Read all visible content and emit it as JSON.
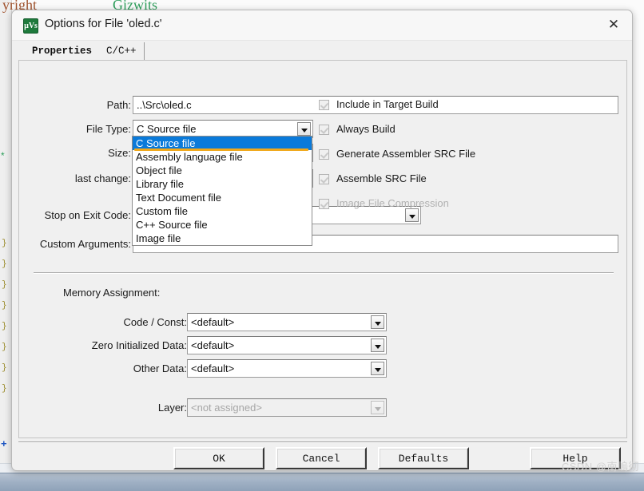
{
  "background": {
    "code_line_left": "yright",
    "code_line_right": "Gizwits",
    "gutter_marks": [
      "}",
      "}",
      "}",
      "}",
      "}",
      "}",
      "}",
      "}"
    ],
    "star_glyph": "*",
    "plus_glyph": "+",
    "slash_glyph": "/"
  },
  "dialog": {
    "title": "Options for File 'oled.c'",
    "icon": "uvision-icon",
    "icon_glyph": "µVs",
    "close_glyph": "✕"
  },
  "tabs": [
    {
      "label": "Properties",
      "active": true
    },
    {
      "label": "C/C++",
      "active": false
    }
  ],
  "fields": {
    "path_label": "Path:",
    "path_value": "..\\Src\\oled.c",
    "file_type_label": "File Type:",
    "file_type_value": "C Source file",
    "size_label": "Size:",
    "size_value": "",
    "last_change_label": "last change:",
    "last_change_value": "",
    "stop_on_exit_label": "Stop on Exit Code:",
    "stop_on_exit_value": "",
    "custom_arguments_label": "Custom Arguments:",
    "custom_arguments_value": ""
  },
  "file_type_dropdown": {
    "open": true,
    "selected_index": 0,
    "highlight_color": "#0a7ada",
    "annotation_color": "#f0a81c",
    "options": [
      "C Source file",
      "Assembly language file",
      "Object file",
      "Library file",
      "Text Document file",
      "Custom file",
      "C++ Source file",
      "Image file"
    ]
  },
  "checkboxes": [
    {
      "label": "Include in Target Build",
      "checked": true,
      "enabled": false
    },
    {
      "label": "Always Build",
      "checked": true,
      "enabled": false
    },
    {
      "label": "Generate Assembler SRC File",
      "checked": true,
      "enabled": false
    },
    {
      "label": "Assemble SRC File",
      "checked": true,
      "enabled": false
    },
    {
      "label": "Image File Compression",
      "checked": true,
      "enabled": false
    }
  ],
  "memory_assignment": {
    "section_label": "Memory Assignment:",
    "rows": [
      {
        "label": "Code / Const:",
        "value": "<default>",
        "enabled": true
      },
      {
        "label": "Zero Initialized Data:",
        "value": "<default>",
        "enabled": true
      },
      {
        "label": "Other Data:",
        "value": "<default>",
        "enabled": true
      }
    ],
    "layer": {
      "label": "Layer:",
      "value": "<not assigned>",
      "enabled": false
    }
  },
  "footer": {
    "ok": "OK",
    "cancel": "Cancel",
    "defaults": "Defaults",
    "help": "Help"
  },
  "watermark": "CSDN @南嵨彻"
}
